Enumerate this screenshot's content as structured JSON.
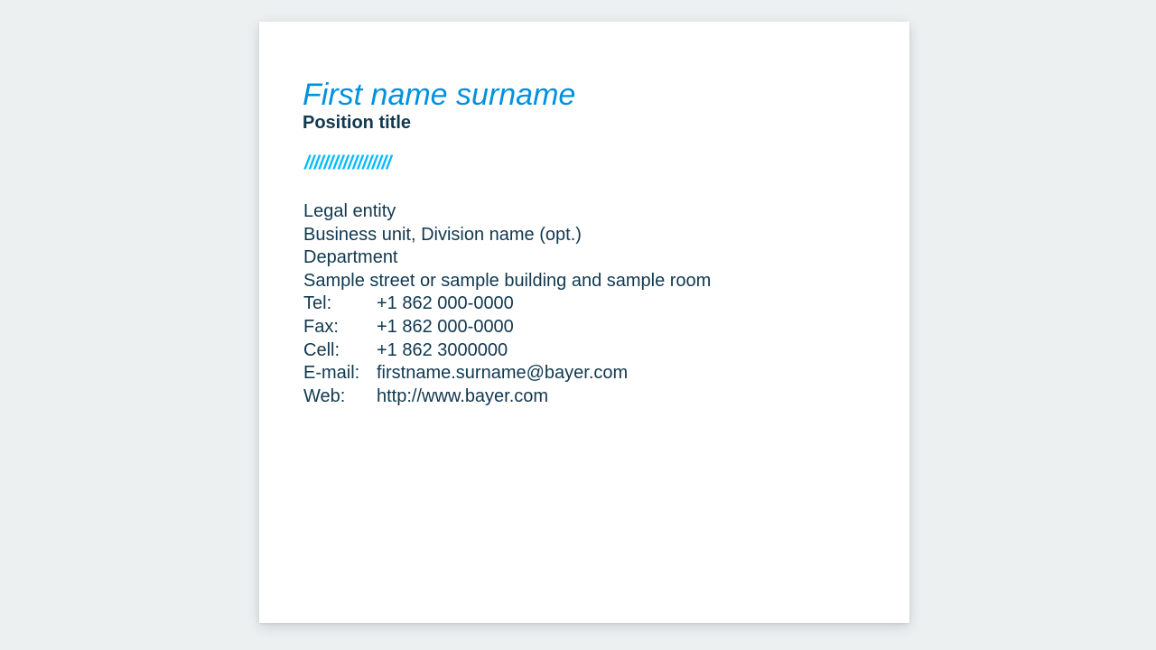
{
  "signature": {
    "name": "First name surname",
    "position_title": "Position title",
    "divider": "//////////////////",
    "brand_color": "#0091df",
    "divider_color": "#00bcff",
    "text_color": "#10384f"
  },
  "address": {
    "legal_entity": "Legal entity",
    "business_unit": "Business unit, Division name (opt.)",
    "department": "Department",
    "street": "Sample street or sample building and sample room"
  },
  "contacts": [
    {
      "label": "Tel:",
      "value": "+1 862 000-0000"
    },
    {
      "label": "Fax:",
      "value": "+1 862 000-0000"
    },
    {
      "label": "Cell:",
      "value": "+1 862 3000000"
    },
    {
      "label": "E-mail:",
      "value": "firstname.surname@bayer.com"
    },
    {
      "label": "Web:",
      "value": "http://www.bayer.com"
    }
  ]
}
